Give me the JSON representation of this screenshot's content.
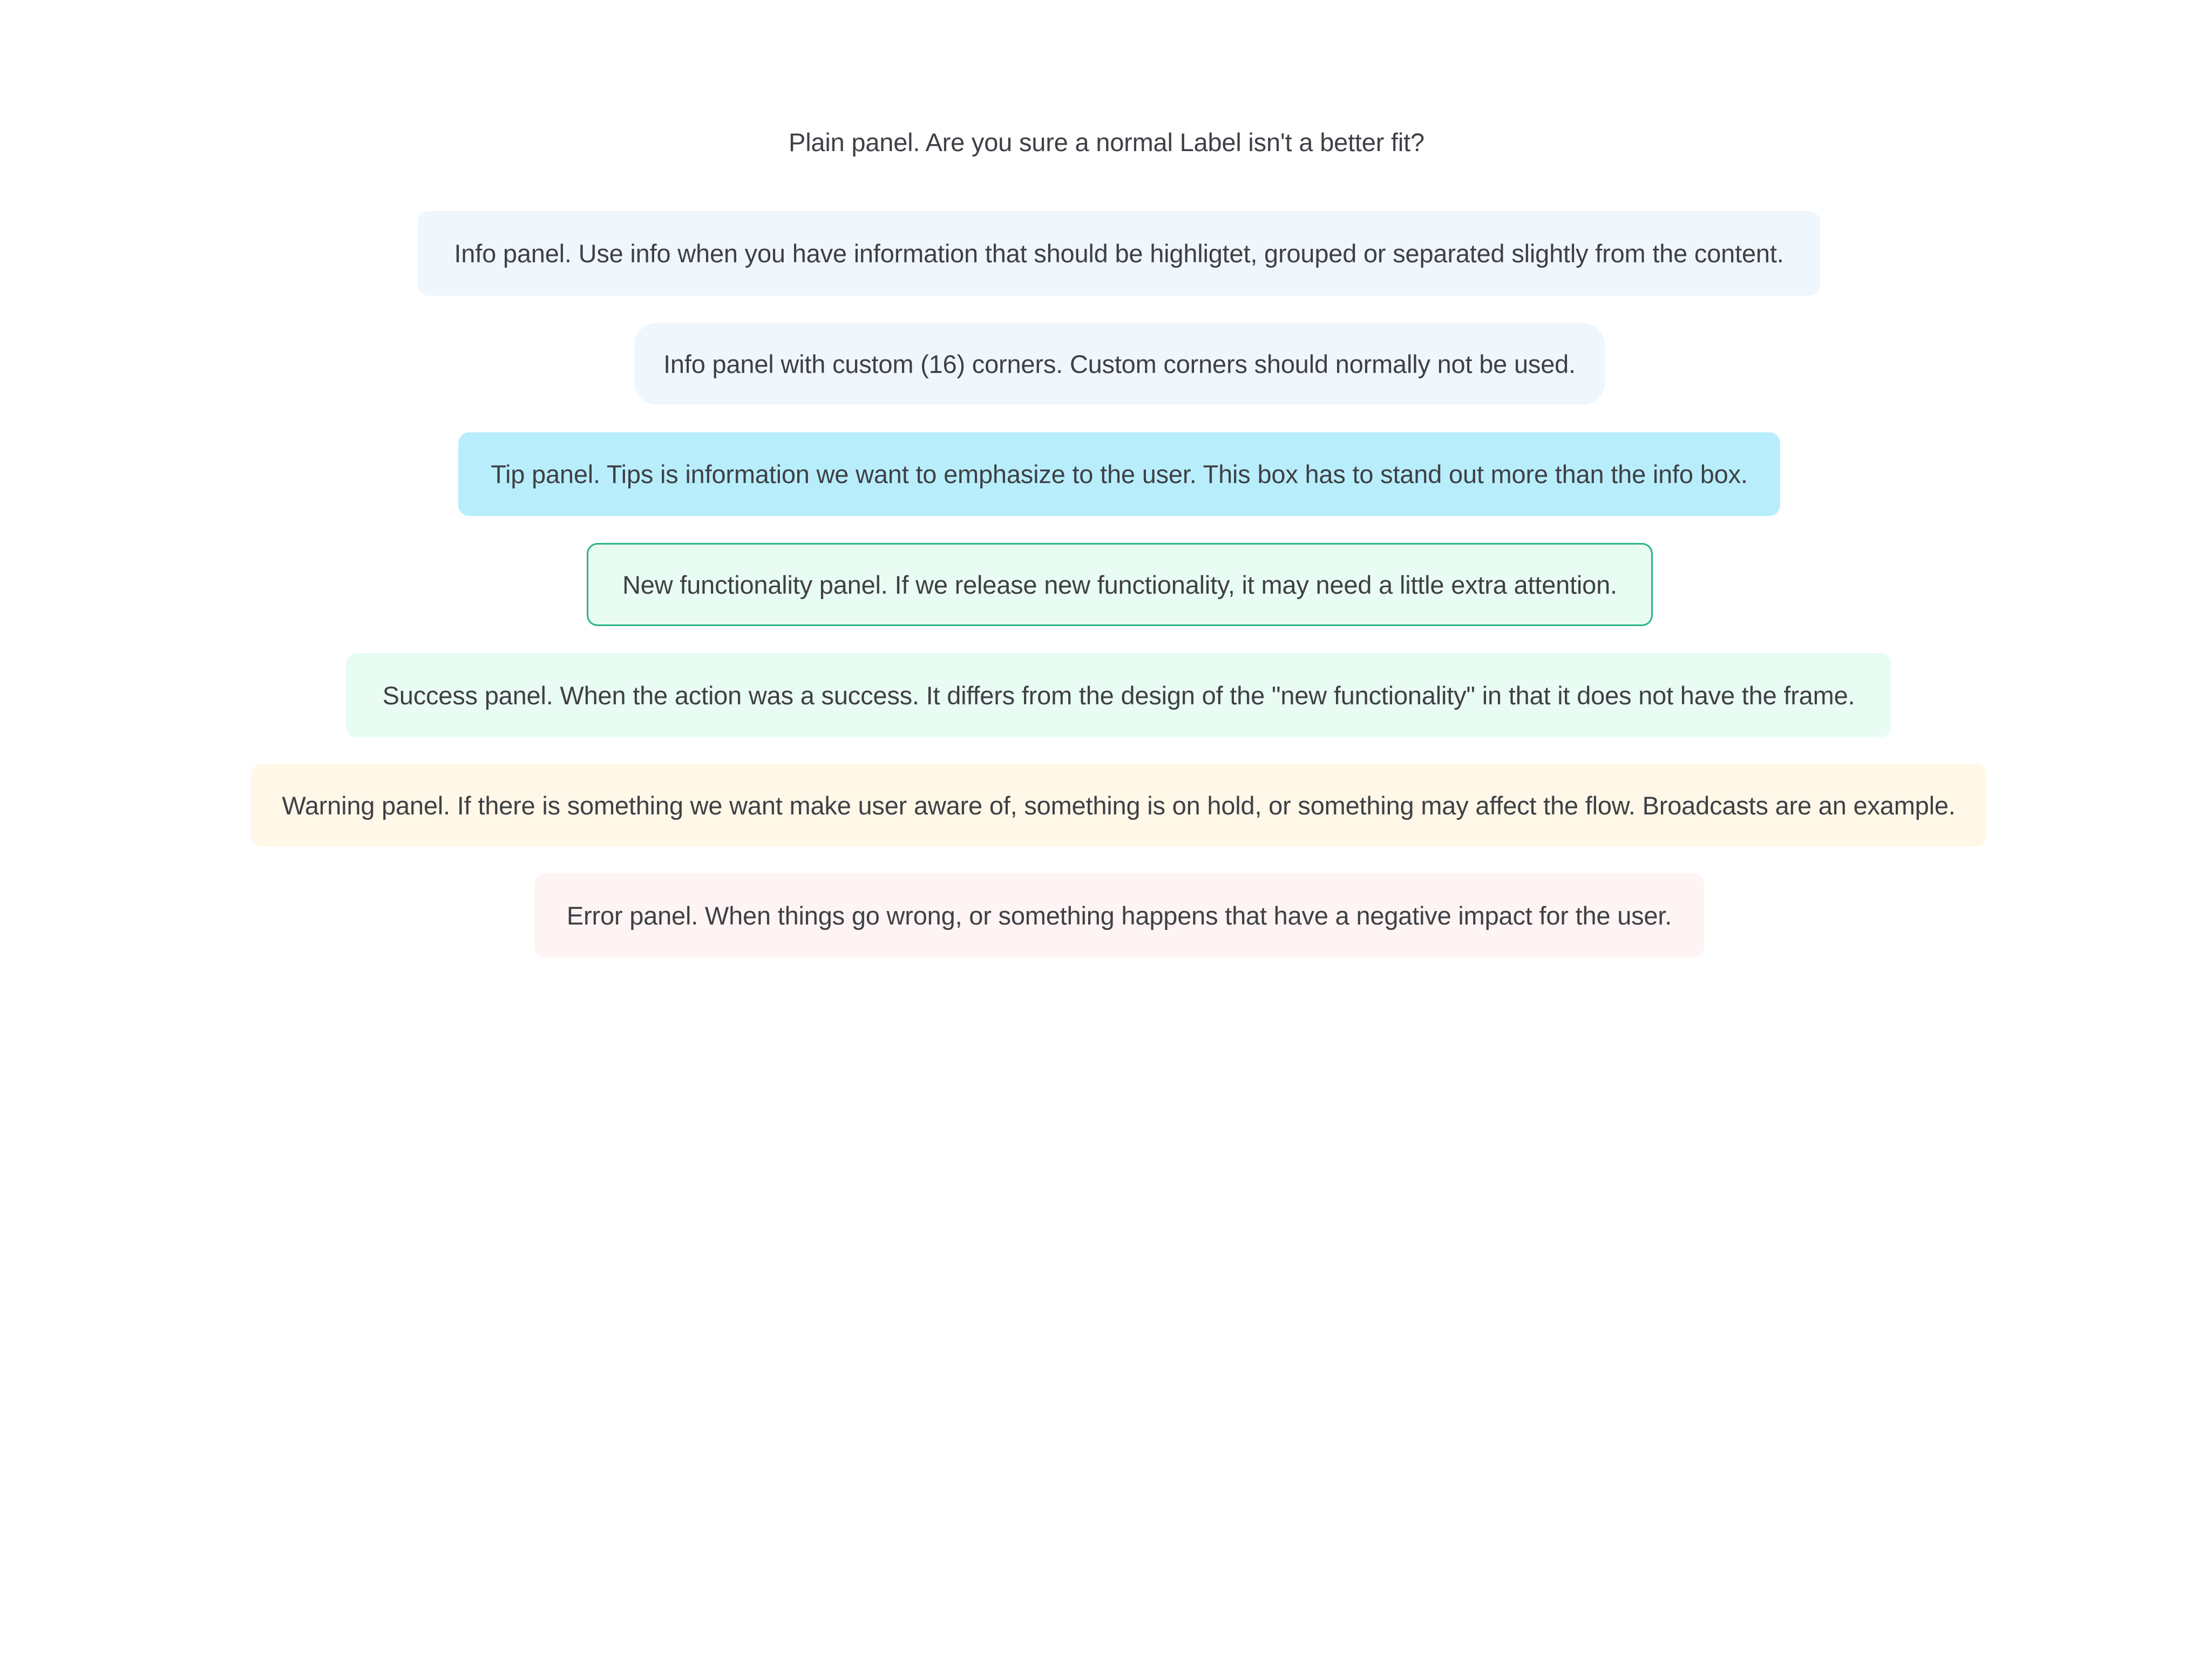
{
  "panels": {
    "plain": "Plain panel. Are you sure a normal Label isn't a better fit?",
    "info": "Info panel. Use info when you have information that should be highligtet, grouped or separated slightly from the content.",
    "info_custom_corners": "Info panel with custom (16) corners. Custom corners should normally not be used.",
    "tip": "Tip panel. Tips is information we want to emphasize to the user. This box has to stand out more than the info box.",
    "new_functionality": "New functionality panel. If we release new functionality, it may need a little extra attention.",
    "success": "Success panel. When the action was a success. It differs from the design of the \"new functionality\" in that it does not have the frame.",
    "warning": "Warning panel. If there is something we want make user aware of, something is on hold, or something may affect the flow. Broadcasts are an example.",
    "error": "Error panel. When things go wrong, or something happens that have a negative impact for the user."
  },
  "colors": {
    "text": "#3f4046",
    "info_bg": "#f0f7fc",
    "tip_bg": "#b8eefc",
    "new_functionality_bg": "#e9fcf3",
    "new_functionality_border": "#2bb580",
    "success_bg": "#e9fcf3",
    "warning_bg": "#fff8e8",
    "error_bg": "#fdf4f3"
  }
}
